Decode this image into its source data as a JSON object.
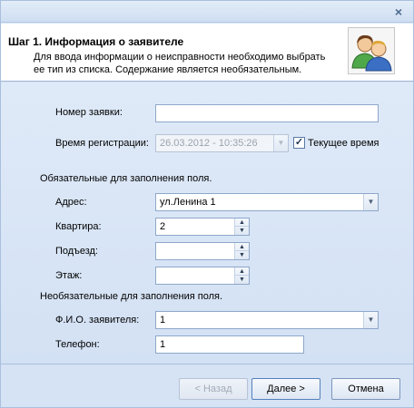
{
  "window": {
    "close_glyph": "×"
  },
  "header": {
    "title": "Шаг 1. Информация о заявителе",
    "desc_line1": "Для ввода информации о неисправности необходимо выбрать",
    "desc_line2": "ее тип из списка. Содержание является необязательным.",
    "icon": "users-icon"
  },
  "form": {
    "request_number": {
      "label": "Номер заявки:",
      "value": ""
    },
    "reg_time": {
      "label": "Время регистрации:",
      "value": "26.03.2012  -  10:35:26"
    },
    "current_time": {
      "label": "Текущее время",
      "checked": true
    },
    "required_section": "Обязательные для заполнения поля.",
    "address": {
      "label": "Адрес:",
      "value": "ул.Ленина 1"
    },
    "apartment": {
      "label": "Квартира:",
      "value": "2"
    },
    "entrance": {
      "label": "Подъезд:",
      "value": ""
    },
    "floor": {
      "label": "Этаж:",
      "value": ""
    },
    "optional_section": "Необязательные для заполнения поля.",
    "applicant": {
      "label": "Ф.И.О. заявителя:",
      "value": "1"
    },
    "phone": {
      "label": "Телефон:",
      "value": "1"
    }
  },
  "buttons": {
    "back": "< Назад",
    "next": "Далее >",
    "cancel": "Отмена"
  },
  "colors": {
    "accent_border": "#8ea7c9",
    "background": "#d9e6f7"
  }
}
